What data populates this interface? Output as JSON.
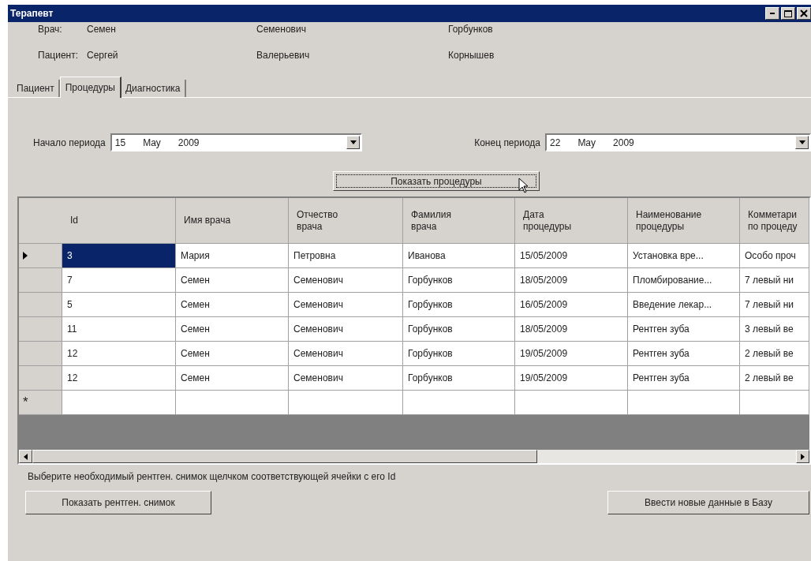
{
  "window": {
    "title": "Терапевт"
  },
  "people": [
    {
      "label": "Врач:",
      "first": "Семен",
      "middle": "Семенович",
      "last": "Горбунков"
    },
    {
      "label": "Пациент:",
      "first": "Сергей",
      "middle": "Валерьевич",
      "last": "Корнышев"
    }
  ],
  "tabs": [
    {
      "label": "Пациент",
      "selected": false
    },
    {
      "label": "Процедуры",
      "selected": true
    },
    {
      "label": "Диагностика",
      "selected": false
    }
  ],
  "period": [
    {
      "label": "Начало периода",
      "day": "15",
      "month": "May",
      "year": "2009"
    },
    {
      "label": "Конец периода",
      "day": "22",
      "month": "May",
      "year": "2009"
    }
  ],
  "show_button": "Показать процедуры",
  "table": {
    "columns": [
      "Id",
      "Имя врача",
      "Отчество врача",
      "Фамилия врача",
      "Дата процедуры",
      "Наименование процедуры",
      "Комметари по процеду"
    ],
    "rows": [
      {
        "selected": true,
        "cells": [
          "3",
          "Мария",
          "Петровна",
          "Иванова",
          "15/05/2009",
          "Установка вре...",
          "Особо проч"
        ]
      },
      {
        "selected": false,
        "cells": [
          "7",
          "Семен",
          "Семенович",
          "Горбунков",
          "18/05/2009",
          "Пломбирование...",
          "7 левый ни"
        ]
      },
      {
        "selected": false,
        "cells": [
          "5",
          "Семен",
          "Семенович",
          "Горбунков",
          "16/05/2009",
          "Введение лекар...",
          "7 левый ни"
        ]
      },
      {
        "selected": false,
        "cells": [
          "11",
          "Семен",
          "Семенович",
          "Горбунков",
          "18/05/2009",
          "Рентген зуба",
          "3 левый ве"
        ]
      },
      {
        "selected": false,
        "cells": [
          "12",
          "Семен",
          "Семенович",
          "Горбунков",
          "19/05/2009",
          "Рентген зуба",
          "2 левый ве"
        ]
      },
      {
        "selected": false,
        "cells": [
          "12",
          "Семен",
          "Семенович",
          "Горбунков",
          "19/05/2009",
          "Рентген зуба",
          "2 левый ве"
        ]
      }
    ],
    "new_row_marker": "*"
  },
  "hint": "Выберите необходимый рентген. снимок щелчком соответствующей ячейки с его Id",
  "buttons": [
    "Показать рентген. снимок",
    "Ввести новые данные в Базу"
  ]
}
